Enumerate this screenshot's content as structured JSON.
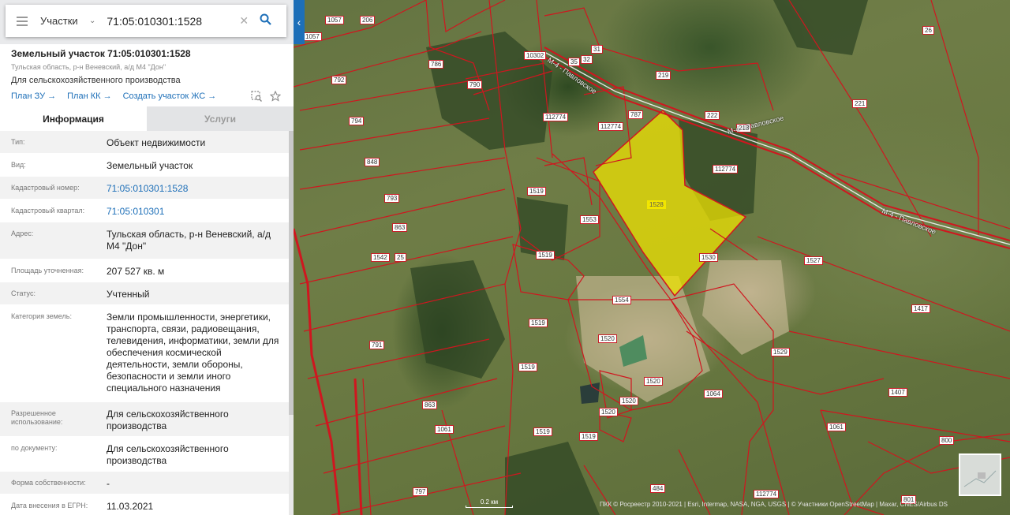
{
  "search": {
    "category": "Участки",
    "query": "71:05:010301:1528"
  },
  "parcel": {
    "title": "Земельный участок 71:05:010301:1528",
    "address_short": "Тульская область, р-н Веневский, а/д М4 \"Дон\"",
    "usage": "Для сельскохозяйственного производства"
  },
  "links": {
    "plan_zu": "План ЗУ →",
    "plan_kk": "План КК →",
    "create_zs": "Создать участок ЖС →"
  },
  "tabs": {
    "info": "Информация",
    "services": "Услуги"
  },
  "rows": [
    {
      "label": "Тип:",
      "value": "Объект недвижимости"
    },
    {
      "label": "Вид:",
      "value": "Земельный участок"
    },
    {
      "label": "Кадастровый номер:",
      "value": "71:05:010301:1528"
    },
    {
      "label": "Кадастровый квартал:",
      "value": "71:05:010301"
    },
    {
      "label": "Адрес:",
      "value": "Тульская область, р-н Веневский, а/д М4 \"Дон\""
    },
    {
      "label": "Площадь уточненная:",
      "value": "207 527 кв. м"
    },
    {
      "label": "Статус:",
      "value": "Учтенный"
    },
    {
      "label": "Категория земель:",
      "value": "Земли промышленности, энергетики, транспорта, связи, радиовещания, телевидения, информатики, земли для обеспечения космической деятельности, земли обороны, безопасности и земли иного специального назначения"
    },
    {
      "label": "Разрешенное использование:",
      "value": "Для сельскохозяйственного производства"
    },
    {
      "label": "по документу:",
      "value": "Для сельскохозяйственного производства"
    },
    {
      "label": "Форма собственности:",
      "value": "-"
    },
    {
      "label": "Дата внесения в ЕГРН:",
      "value": "11.03.2021"
    }
  ],
  "map": {
    "labels": [
      "1057",
      "206",
      "1057",
      "786",
      "10302",
      "35",
      "32",
      "31",
      "219",
      "26",
      "792",
      "790",
      "221",
      "1528",
      "112774",
      "787",
      "222",
      "218",
      "112774",
      "794",
      "112774",
      "848",
      "1519",
      "1553",
      "793",
      "863",
      "1542",
      "25",
      "1519",
      "1530",
      "1527",
      "1554",
      "1519",
      "1520",
      "1417",
      "791",
      "1529",
      "1519",
      "1520",
      "1064",
      "1407",
      "863",
      "1520",
      "1520",
      "1061",
      "1061",
      "1519",
      "1519",
      "800",
      "797",
      "484",
      "112774",
      "801"
    ],
    "roads": [
      "М-4 - Павловское",
      "М-4 - Павловское",
      "М-4 - Павловское"
    ],
    "scale": "0.2 км",
    "credits": "ПКК © Росреестр 2010-2021 | Esri, Intermap, NASA, NGA, USGS | © Участники OpenStreetMap | Maxar, CNES/Airbus DS"
  },
  "colors": {
    "accent": "#1d6fb8",
    "parcel_border": "#d0161f",
    "selected_fill": "#f2e600"
  }
}
